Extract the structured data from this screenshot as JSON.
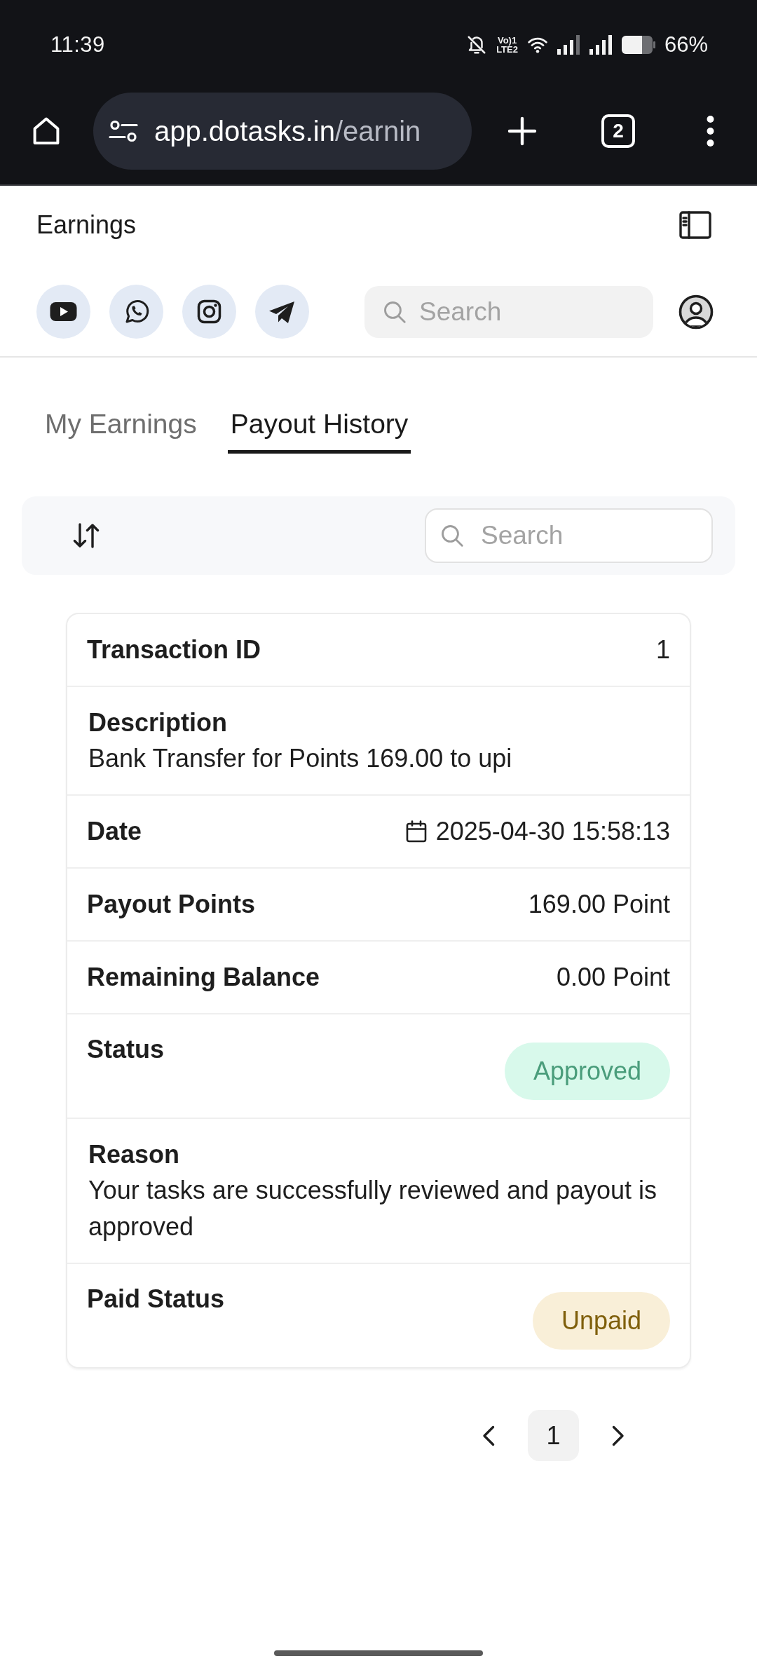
{
  "status_bar": {
    "time": "11:39",
    "network_type": [
      "Vo)1",
      "LTE2"
    ],
    "battery": "66%"
  },
  "browser": {
    "url_host": "app.dotasks.in",
    "url_path": "/earnin",
    "tab_count": "2"
  },
  "header": {
    "title": "Earnings",
    "social_links": [
      {
        "kind": "video"
      },
      {
        "kind": "chat"
      },
      {
        "kind": "camera"
      },
      {
        "kind": "plane"
      }
    ],
    "search": {
      "placeholder": "Search"
    }
  },
  "tabs": [
    {
      "label": "My Earnings",
      "selected": false
    },
    {
      "label": "Payout History",
      "selected": true
    }
  ],
  "toolbar": {
    "search": {
      "placeholder": "Search"
    }
  },
  "payout": {
    "rows": [
      {
        "kind": "inline",
        "label": "Transaction ID",
        "value": "1"
      },
      {
        "kind": "stacked",
        "label": "Description",
        "value": "Bank Transfer for Points 169.00 to upi"
      },
      {
        "kind": "date",
        "label": "Date",
        "value": "2025-04-30 15:58:13"
      },
      {
        "kind": "inline",
        "label": "Payout Points",
        "value": "169.00 Point"
      },
      {
        "kind": "inline",
        "label": "Remaining Balance",
        "value": "0.00 Point"
      },
      {
        "kind": "badge",
        "label": "Status",
        "value": "Approved",
        "color": "#4a9d7b"
      },
      {
        "kind": "stacked",
        "label": "Reason",
        "value": "Your tasks are successfully reviewed and payout is approved"
      },
      {
        "kind": "badge",
        "label": "Paid Status",
        "value": "Unpaid",
        "color": "#7f5f0b"
      }
    ]
  },
  "pagination": {
    "pages": [
      {
        "label": "1",
        "selected": true
      }
    ]
  }
}
